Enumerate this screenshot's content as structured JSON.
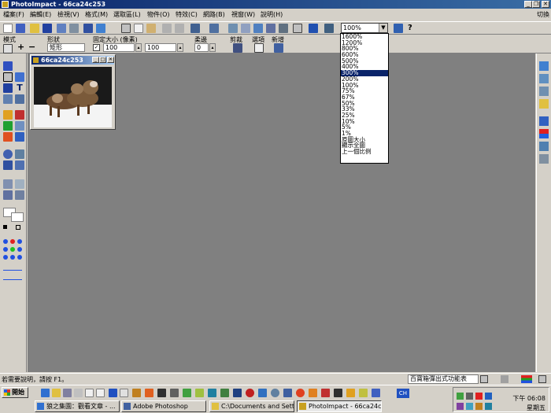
{
  "window": {
    "title": "PhotoImpact - 66ca24c253"
  },
  "menu": {
    "items": [
      "檔案(F)",
      "編輯(E)",
      "檢視(V)",
      "格式(M)",
      "選取區(L)",
      "物件(O)",
      "特效(C)",
      "網路(B)",
      "視窗(W)",
      "說明(H)"
    ],
    "right": "切換"
  },
  "toolbar": {
    "zoom_value": "100%"
  },
  "attribute_bar": {
    "mode_label": "模式",
    "shape_label": "形狀",
    "shape_value": "矩形",
    "fixed_size_label": "固定大小 (像素)",
    "width_value": "100",
    "height_value": "100",
    "soft_edge_label": "柔邊",
    "soft_edge_value": "0",
    "crop_label": "剪裁",
    "options_label": "選項",
    "add_label": "新增"
  },
  "document": {
    "title": "66ca24c253"
  },
  "zoom_list": {
    "options": [
      "1600%",
      "1200%",
      "800%",
      "600%",
      "500%",
      "400%",
      "300%",
      "200%",
      "100%",
      "75%",
      "67%",
      "50%",
      "33%",
      "25%",
      "10%",
      "5%",
      "1%",
      "原圖大小",
      "顯示全圖",
      "上一個比例"
    ],
    "selected_index": 6
  },
  "status": {
    "hint": "若需要說明，請按 F1。",
    "combo": "百寶箱彈出式功能表"
  },
  "taskbar": {
    "start": "開始",
    "tasks": [
      "狼之集園：觀看文章 - ...",
      "Adobe Photoshop",
      "C:\\Documents and Setting...",
      "PhotoImpact - 66ca24c253"
    ],
    "time": "下午 06:08",
    "day": "星期五"
  },
  "colors": {
    "title_active": "#0a246a",
    "workspace": "#808080",
    "face": "#d4d0c8",
    "selection": "#0a246a"
  }
}
